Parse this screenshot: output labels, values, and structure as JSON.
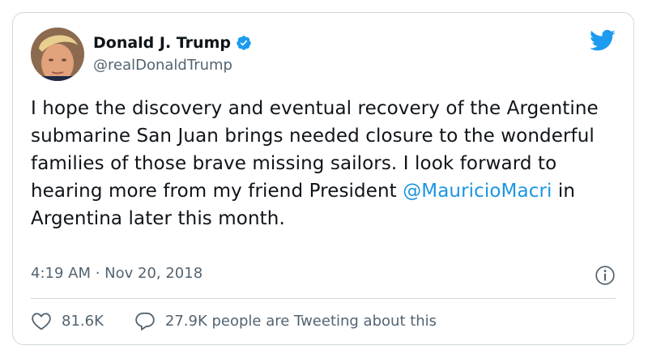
{
  "author": {
    "display_name": "Donald J. Trump",
    "handle": "@realDonaldTrump",
    "verified": true
  },
  "tweet": {
    "text_before_mention": "I hope the discovery and eventual recovery of the Argentine submarine San Juan brings needed closure to the wonderful families of those brave missing sailors. I look forward to hearing more from my friend President ",
    "mention": "@MauricioMacri",
    "text_after_mention": " in Argentina later this month.",
    "timestamp": "4:19 AM · Nov 20, 2018"
  },
  "stats": {
    "likes": "81.6K",
    "tweeting": "27.9K people are Tweeting about this"
  },
  "icons": [
    "verified-badge-icon",
    "twitter-bird-icon",
    "info-icon",
    "heart-icon",
    "comment-bubble-icon"
  ],
  "colors": {
    "accent": "#1d9bf0",
    "mention": "#1b95e0",
    "text": "#0f1419",
    "secondary_text": "#536471",
    "border": "#cfd9de"
  }
}
